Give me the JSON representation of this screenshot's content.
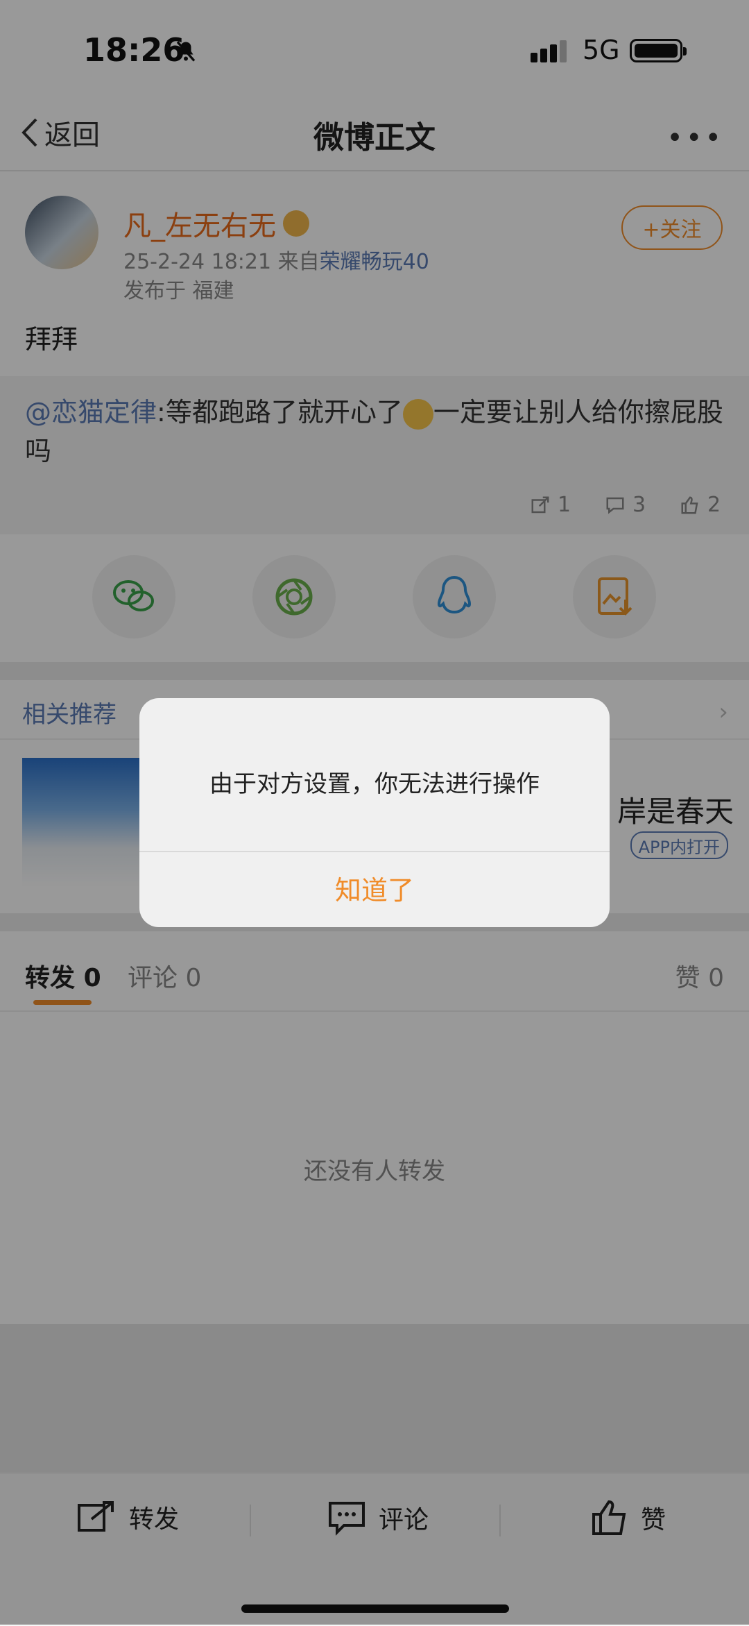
{
  "status": {
    "time": "18:26",
    "network": "5G"
  },
  "nav": {
    "back": "返回",
    "title": "微博正文",
    "more": "•••"
  },
  "post": {
    "username": "凡_左无右无",
    "time": "25-2-24 18:21",
    "from_prefix": "来自",
    "source": "荣耀畅玩40",
    "location": "发布于 福建",
    "follow_label": "+关注",
    "content": "拜拜",
    "repost": {
      "mention": "@恋猫定律",
      "text_before_emoji": ":等都跑路了就开心了",
      "text_after_emoji": "一定要让别人给你擦屁股吗",
      "repost_count": "1",
      "comment_count": "3",
      "like_count": "2"
    }
  },
  "share": {
    "items": [
      "wechat-icon",
      "moments-icon",
      "qq-icon",
      "save-image-icon"
    ]
  },
  "recommend": {
    "title": "相关推荐",
    "text": "岸是春天",
    "app_tag": "APP内打开"
  },
  "tabs": {
    "repost": "转发",
    "repost_count": "0",
    "comment": "评论",
    "comment_count": "0",
    "like": "赞",
    "like_count": "0"
  },
  "empty_text": "还没有人转发",
  "bottom": {
    "repost": "转发",
    "comment": "评论",
    "like": "赞"
  },
  "dialog": {
    "message": "由于对方设置，你无法进行操作",
    "button": "知道了"
  },
  "colors": {
    "accent": "#f08c2a",
    "link": "#5a7bb5",
    "username": "#e86a1a"
  }
}
